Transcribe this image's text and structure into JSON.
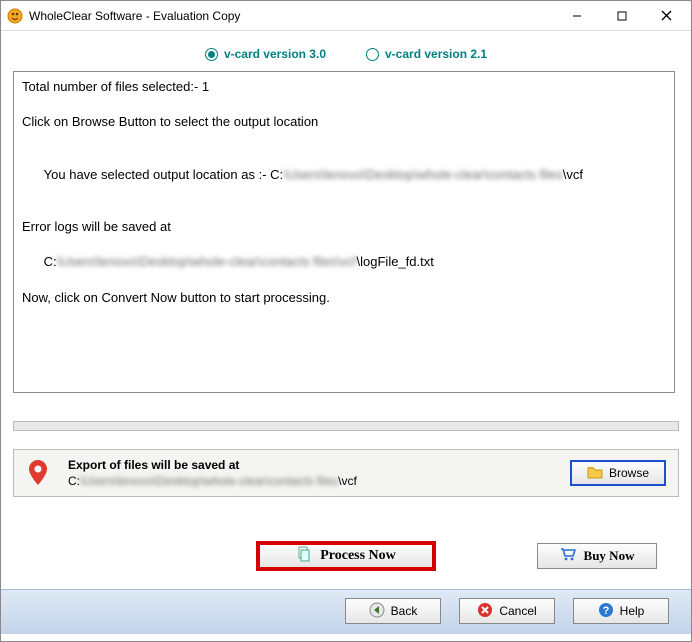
{
  "titlebar": {
    "title": "WholeClear Software - Evaluation Copy"
  },
  "versions": {
    "v30": "v-card version 3.0",
    "v21": "v-card version 2.1",
    "selected": "v30"
  },
  "log": {
    "line1": "Total number of files selected:- 1",
    "line2": "Click on Browse Button to select the output location",
    "line3_prefix": "You have selected output location as :- C:",
    "line3_blur": "\\Users\\lenovo\\Desktop\\whole-clear\\contacts files",
    "line3_suffix": "\\vcf",
    "line4": "Error logs will be saved at",
    "line5_prefix": "C:",
    "line5_blur": "\\Users\\lenovo\\Desktop\\whole-clear\\contacts files\\vcf",
    "line5_suffix": "\\logFile_fd.txt",
    "line6": "Now, click on Convert Now button to start processing."
  },
  "export": {
    "heading": "Export of files will be saved at",
    "path_prefix": "C:",
    "path_blur": "\\Users\\lenovo\\Desktop\\whole-clear\\contacts files",
    "path_suffix": "\\vcf",
    "browse": "Browse"
  },
  "actions": {
    "process": "Process Now",
    "buy": "Buy Now"
  },
  "footer": {
    "back": "Back",
    "cancel": "Cancel",
    "help": "Help"
  }
}
